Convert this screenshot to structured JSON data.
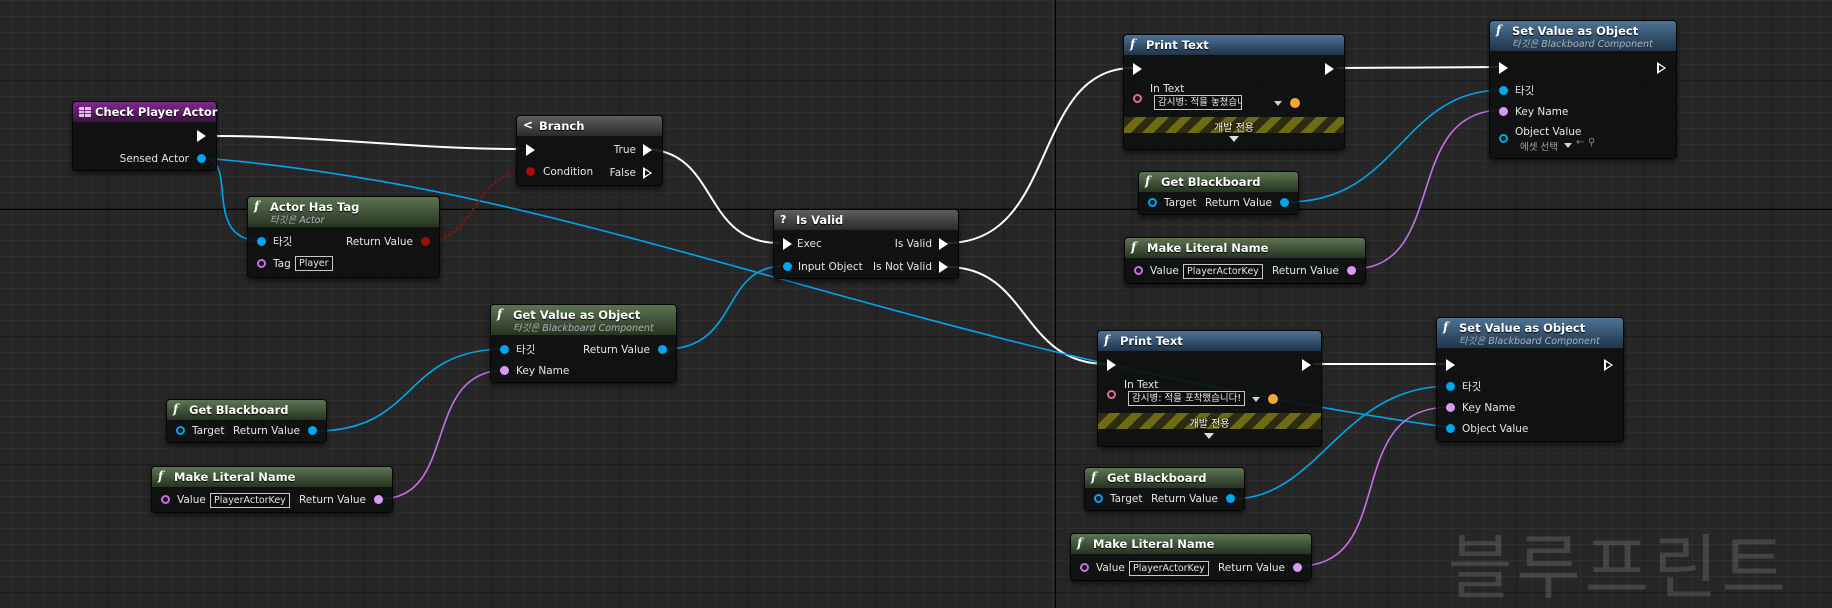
{
  "watermark": "블루프린트",
  "nodes": {
    "check_player_actor": {
      "title": "Check Player Actor",
      "sensed_actor": "Sensed Actor"
    },
    "actor_has_tag": {
      "title": "Actor Has Tag",
      "subtitle": "타깃은 Actor",
      "target": "타깃",
      "tag": "Tag",
      "tag_value": "Player",
      "return_value": "Return Value"
    },
    "branch": {
      "title": "Branch",
      "condition": "Condition",
      "true_label": "True",
      "false_label": "False"
    },
    "get_value_as_object": {
      "title": "Get Value as Object",
      "subtitle": "타깃은 Blackboard Component",
      "target": "타깃",
      "key_name": "Key Name",
      "return_value": "Return Value"
    },
    "get_blackboard_1": {
      "title": "Get Blackboard",
      "target": "Target",
      "return_value": "Return Value"
    },
    "make_literal_name_1": {
      "title": "Make Literal Name",
      "value": "Value",
      "value_text": "PlayerActorKey",
      "return_value": "Return Value"
    },
    "is_valid": {
      "title": "Is Valid",
      "exec": "Exec",
      "input_object": "Input Object",
      "is_valid": "Is Valid",
      "is_not_valid": "Is Not Valid"
    },
    "print_text_1": {
      "title": "Print Text",
      "in_text": "In Text",
      "text_value": "감시병: 적을 놓쳤습니다...",
      "dev_only": "개발 전용"
    },
    "get_blackboard_2": {
      "title": "Get Blackboard",
      "target": "Target",
      "return_value": "Return Value"
    },
    "make_literal_name_2": {
      "title": "Make Literal Name",
      "value": "Value",
      "value_text": "PlayerActorKey",
      "return_value": "Return Value"
    },
    "set_value_1": {
      "title": "Set Value as Object",
      "subtitle": "타깃은 Blackboard Component",
      "target": "타깃",
      "key_name": "Key Name",
      "object_value": "Object Value",
      "asset_select": "에셋 선택"
    },
    "print_text_2": {
      "title": "Print Text",
      "in_text": "In Text",
      "text_value": "감시병: 적을 포착했습니다!",
      "dev_only": "개발 전용"
    },
    "get_blackboard_3": {
      "title": "Get Blackboard",
      "target": "Target",
      "return_value": "Return Value"
    },
    "make_literal_name_3": {
      "title": "Make Literal Name",
      "value": "Value",
      "value_text": "PlayerActorKey",
      "return_value": "Return Value"
    },
    "set_value_2": {
      "title": "Set Value as Object",
      "subtitle": "타깃은 Blackboard Component",
      "target": "타깃",
      "key_name": "Key Name",
      "object_value": "Object Value"
    }
  }
}
